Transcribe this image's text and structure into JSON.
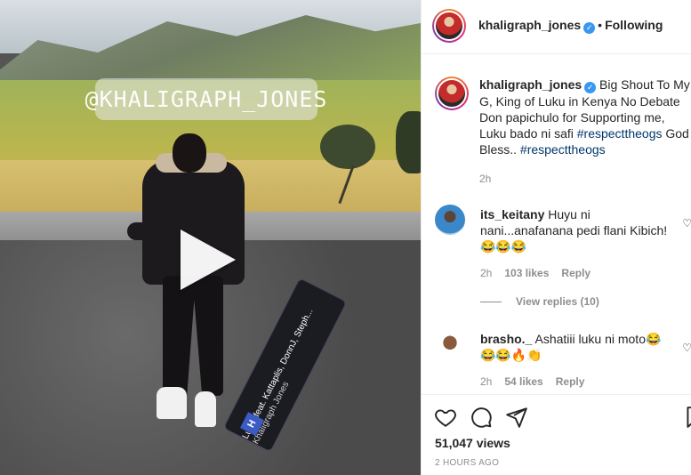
{
  "video": {
    "watermark": "@KHALIGRAPH_JONES",
    "music_title": "Luku (feat. Kattaplis, DonnJ, Steph...",
    "music_artist": "Khaligraph Jones",
    "music_logo": "H"
  },
  "header": {
    "username": "khaligraph_jones",
    "verified_icon": "verified-badge-icon",
    "separator": "•",
    "follow_status": "Following"
  },
  "caption": {
    "username": "khaligraph_jones",
    "text_part1": "Big Shout To My G, King of Luku in Kenya No Debate Don papichulo for Supporting me, Luku bado ni safi ",
    "hashtag1": "#respecttheogs",
    "text_part2": " God Bless.. ",
    "hashtag2": "#respecttheogs",
    "time": "2h"
  },
  "comments": [
    {
      "username": "its_keitany",
      "text": "Huyu ni nani...anafanana pedi flani Kibich!",
      "emojis": "😂😂😂",
      "time": "2h",
      "likes": "103 likes",
      "reply": "Reply"
    },
    {
      "username": "brasho._",
      "text": "Ashatiii luku ni moto",
      "emoji_inline": "😂",
      "emojis": "😂😂🔥👏",
      "time": "2h",
      "likes": "54 likes",
      "reply": "Reply"
    }
  ],
  "view_replies": "View replies (10)",
  "footer": {
    "views": "51,047 views",
    "posted": "2 HOURS AGO"
  },
  "colors": {
    "link": "#00376b",
    "muted": "#8e8e8e",
    "verified": "#3897f0"
  }
}
